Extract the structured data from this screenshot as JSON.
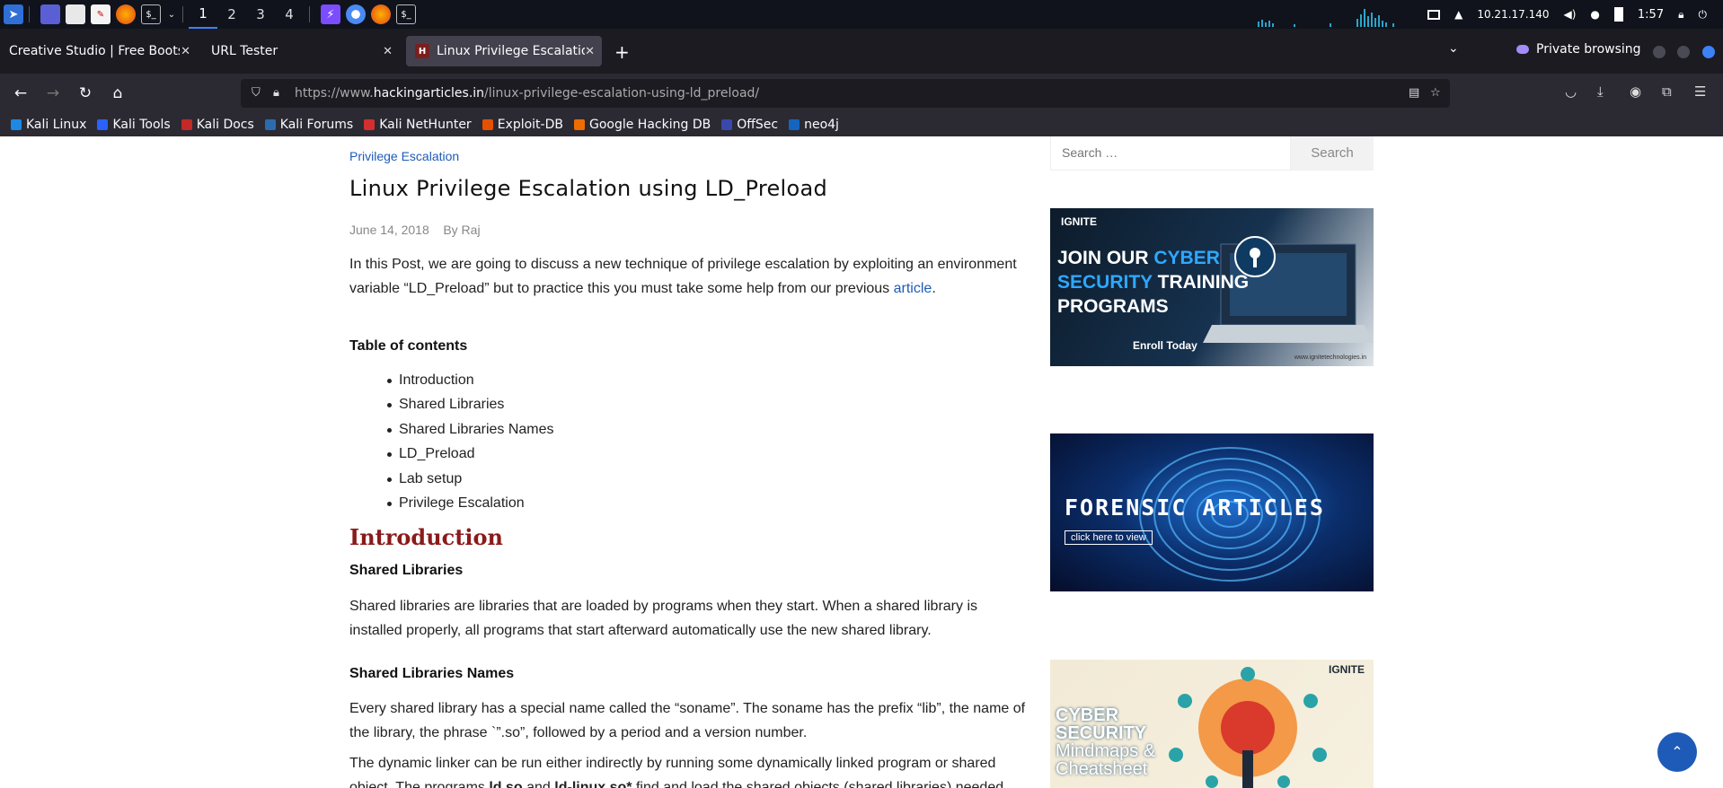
{
  "taskbar": {
    "workspaces": [
      "1",
      "2",
      "3",
      "4"
    ],
    "ip": "10.21.17.140",
    "clock": "1:57"
  },
  "tabs": [
    {
      "title": "Creative Studio | Free Bootstr"
    },
    {
      "title": "URL Tester"
    },
    {
      "title": "Linux Privilege Escalation"
    }
  ],
  "private_label": "Private browsing",
  "url": {
    "prefix": "https://www.",
    "host": "hackingarticles.in",
    "path": "/linux-privilege-escalation-using-ld_preload/"
  },
  "bookmarks": [
    {
      "label": "Kali Linux",
      "color": "#1e88e5"
    },
    {
      "label": "Kali Tools",
      "color": "#2962ff"
    },
    {
      "label": "Kali Docs",
      "color": "#c62828"
    },
    {
      "label": "Kali Forums",
      "color": "#2b6cb0"
    },
    {
      "label": "Kali NetHunter",
      "color": "#d32f2f"
    },
    {
      "label": "Exploit-DB",
      "color": "#e65100"
    },
    {
      "label": "Google Hacking DB",
      "color": "#ef6c00"
    },
    {
      "label": "OffSec",
      "color": "#3949ab"
    },
    {
      "label": "neo4j",
      "color": "#1565c0"
    }
  ],
  "article": {
    "category": "Privilege Escalation",
    "title": "Linux Privilege Escalation using LD_Preload",
    "date": "June 14, 2018",
    "by": "By",
    "author": "Raj",
    "intro_p1": "In this Post, we are going to discuss a new technique of privilege escalation by exploiting an environment variable “LD_Preload” but to practice this you must take some help from our previous ",
    "intro_link": "article",
    "intro_end": ".",
    "toc_heading": "Table of contents",
    "toc": [
      "Introduction",
      "Shared Libraries",
      "Shared Libraries Names",
      "LD_Preload",
      "Lab setup",
      "Privilege Escalation"
    ],
    "introduction_heading": "Introduction",
    "shared_lib_heading": "Shared Libraries",
    "shared_lib_text": "Shared libraries are libraries that are loaded by programs when they start. When a shared library is installed properly, all programs that start afterward automatically use the new shared library.",
    "shared_names_heading": "Shared Libraries Names",
    "shared_names_text": "Every shared library has a special name called the “soname”. The soname has the prefix “lib”, the name of the library, the phrase `”.so”, followed by a period and a version number.",
    "linker_text_a": "The dynamic linker can be run either indirectly by running some dynamically linked program or shared object. The programs ",
    "linker_bold1": "ld.so",
    "linker_and": " and ",
    "linker_bold2": "ld-linux.so*",
    "linker_text_b": " find and load the shared objects (shared libraries) needed"
  },
  "sidebar": {
    "search_placeholder": "Search …",
    "search_button": "Search",
    "ad1": {
      "brand": "IGNITE",
      "l1a": "JOIN OUR ",
      "l1b": "CYBER",
      "l2a": "SECURITY",
      "l2b": " TRAINING",
      "l3": "PROGRAMS",
      "enroll": "Enroll Today",
      "site": "www.ignitetechnologies.in"
    },
    "ad2": {
      "title": "FORENSIC ARTICLES",
      "sub": "click here to view"
    },
    "ad3": {
      "brand": "IGNITE",
      "l1": "CYBER",
      "l2": "SECURITY",
      "l3": "Mindmaps &",
      "l4": "Cheatsheet"
    }
  }
}
